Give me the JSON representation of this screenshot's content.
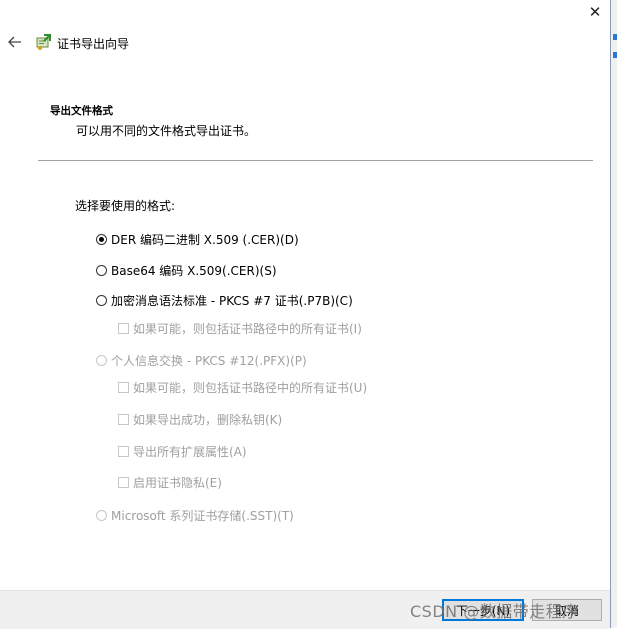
{
  "window": {
    "title": "证书导出向导",
    "close_glyph": "✕",
    "back_glyph": "←"
  },
  "section": {
    "heading": "导出文件格式",
    "description": "可以用不同的文件格式导出证书。"
  },
  "prompt": "选择要使用的格式:",
  "options": [
    {
      "label": "DER 编码二进制 X.509 (.CER)(D)",
      "type": "radio",
      "checked": true,
      "enabled": true
    },
    {
      "label": "Base64 编码 X.509(.CER)(S)",
      "type": "radio",
      "checked": false,
      "enabled": true
    },
    {
      "label": "加密消息语法标准 - PKCS #7 证书(.P7B)(C)",
      "type": "radio",
      "checked": false,
      "enabled": true
    },
    {
      "label": "如果可能，则包括证书路径中的所有证书(I)",
      "type": "checkbox",
      "checked": false,
      "enabled": false
    },
    {
      "label": "个人信息交换 - PKCS #12(.PFX)(P)",
      "type": "radio",
      "checked": false,
      "enabled": false
    },
    {
      "label": "如果可能，则包括证书路径中的所有证书(U)",
      "type": "checkbox",
      "checked": false,
      "enabled": false
    },
    {
      "label": "如果导出成功，删除私钥(K)",
      "type": "checkbox",
      "checked": false,
      "enabled": false
    },
    {
      "label": "导出所有扩展属性(A)",
      "type": "checkbox",
      "checked": false,
      "enabled": false
    },
    {
      "label": "启用证书隐私(E)",
      "type": "checkbox",
      "checked": false,
      "enabled": false
    },
    {
      "label": "Microsoft 系列证书存储(.SST)(T)",
      "type": "radio",
      "checked": false,
      "enabled": false
    }
  ],
  "footer": {
    "next_label": "下一步(N)",
    "cancel_label": "取消"
  },
  "watermark": "CSDN @数据带走程序"
}
